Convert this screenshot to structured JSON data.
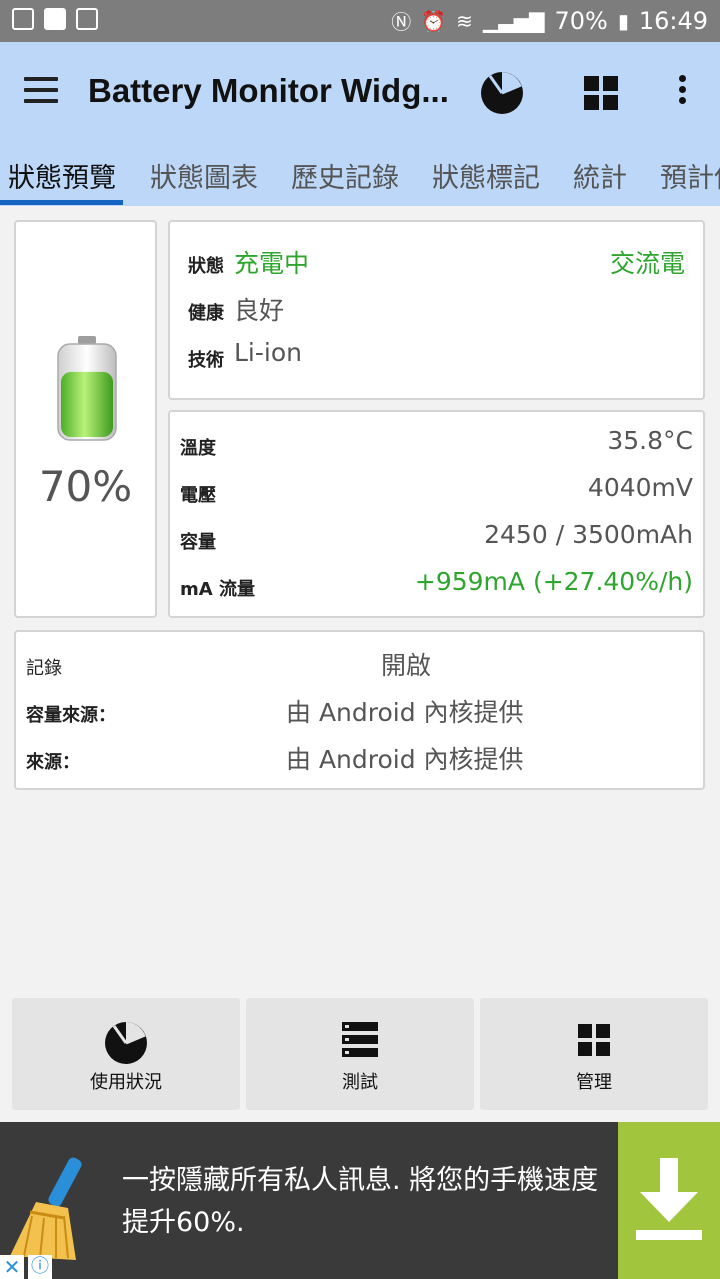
{
  "status_bar": {
    "battery": "70%",
    "time": "16:49"
  },
  "app_bar": {
    "title": "Battery Monitor Widg..."
  },
  "tabs": [
    {
      "label": "狀態預覽",
      "active": true
    },
    {
      "label": "狀態圖表"
    },
    {
      "label": "歷史記錄"
    },
    {
      "label": "狀態標記"
    },
    {
      "label": "統計"
    },
    {
      "label": "預計使"
    }
  ],
  "battery": {
    "percent": "70%",
    "level": 0.7
  },
  "status_card": {
    "status_label": "狀態",
    "status_value": "充電中",
    "power_source": "交流電",
    "health_label": "健康",
    "health_value": "良好",
    "tech_label": "技術",
    "tech_value": "Li-ion"
  },
  "metrics_card": {
    "temp_label": "溫度",
    "temp_value": "35.8°C",
    "voltage_label": "電壓",
    "voltage_value": "4040mV",
    "capacity_label": "容量",
    "capacity_value": "2450 / 3500mAh",
    "current_label": "mA 流量",
    "current_value": "+959mA (+27.40%/h)"
  },
  "log_card": {
    "log_label": "記錄",
    "log_value": "開啟",
    "cap_src_label": "容量來源：",
    "cap_src_value": "由 Android 內核提供",
    "src_label": "來源：",
    "src_value": "由 Android 內核提供"
  },
  "bottom_buttons": {
    "usage": "使用狀況",
    "test": "測試",
    "manage": "管理"
  },
  "ad": {
    "text": "一按隱藏所有私人訊息. 將您的手機速度提升60%."
  },
  "colors": {
    "appbar": "#bcd7f7",
    "accent": "#1565c0",
    "green": "#2fa52f",
    "ad_button": "#a1c63d"
  }
}
